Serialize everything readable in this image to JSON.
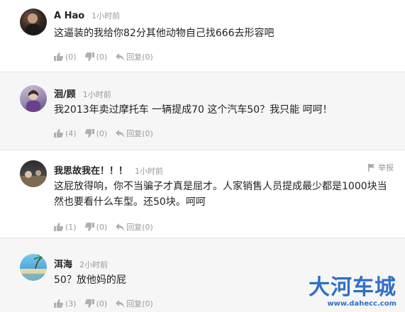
{
  "comments": [
    {
      "username": "A Hao",
      "time": "1小时前",
      "text": "这逼装的我给你82分其他动物自己找666去形容吧",
      "likes": "(0)",
      "dislikes": "(0)",
      "reply_label": "回复(0)"
    },
    {
      "username": "洄/顾",
      "time": "1小时前",
      "text": "我2013年卖过摩托车 一辆提成70 这个汽车50？我只能 呵呵！",
      "likes": "(4)",
      "dislikes": "(0)",
      "reply_label": "回复(0)"
    },
    {
      "username": "我思故我在！！！",
      "time": "1小时前",
      "text": "这屁放得响，你不当骗子才真是屈才。人家销售人员提成最少都是1000块当然也要看什么车型。还50块。呵呵",
      "likes": "(1)",
      "dislikes": "(0)",
      "reply_label": "回复(0)",
      "report_label": "举报"
    },
    {
      "username": "洱海",
      "time": "2小时前",
      "text": "50？放他妈的屁",
      "likes": "(3)",
      "dislikes": "(0)",
      "reply_label": "回复(0)"
    }
  ],
  "watermark": {
    "title": "大河车城",
    "url": "www.dahecc.com"
  },
  "colors": {
    "icon": "#b0b0b0",
    "watermark": "#2f6fc6",
    "alt_bg": "#f6f6f6"
  }
}
